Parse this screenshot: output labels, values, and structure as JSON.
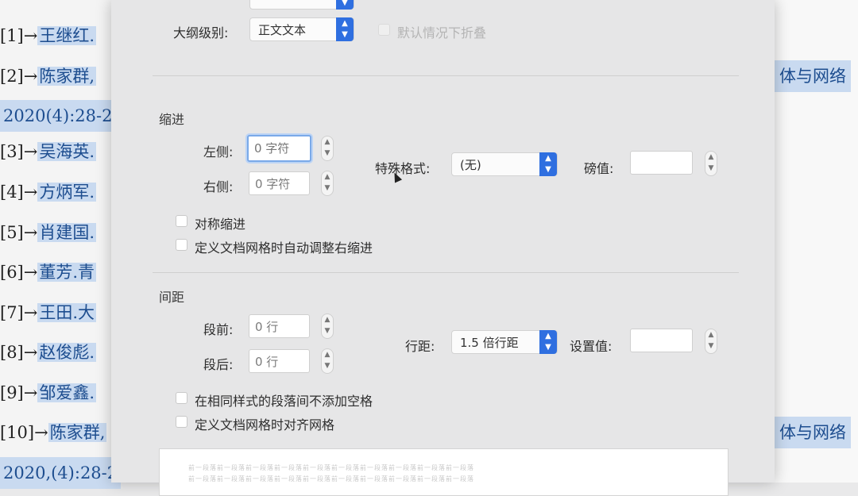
{
  "document": {
    "references": [
      {
        "num": "[1]→",
        "text": "王继红."
      },
      {
        "num": "[2]→",
        "text": "陈家群,"
      },
      {
        "num": "",
        "text": "2020(4):28-2"
      },
      {
        "num": "[3]→",
        "text": "吴海英."
      },
      {
        "num": "[4]→",
        "text": "方炳军."
      },
      {
        "num": "[5]→",
        "text": "肖建国."
      },
      {
        "num": "[6]→",
        "text": "董芳.青"
      },
      {
        "num": "[7]→",
        "text": "王田.大"
      },
      {
        "num": "[8]→",
        "text": "赵俊彪."
      },
      {
        "num": "[9]→",
        "text": "邹爱鑫."
      },
      {
        "num": "[10]→",
        "text": "陈家群,"
      },
      {
        "num": "",
        "text": "2020,(4):28-2"
      }
    ],
    "right_fragments": [
      "体与网络",
      "体与网络"
    ]
  },
  "dialog": {
    "outline_level": {
      "label": "大纲级别:",
      "value": "正文文本"
    },
    "collapse_default": {
      "label": "默认情况下折叠"
    },
    "indent": {
      "title": "缩进",
      "left_label": "左侧:",
      "left_value": "0 字符",
      "right_label": "右侧:",
      "right_value": "0 字符",
      "special_label": "特殊格式:",
      "special_value": "(无)",
      "amount_label": "磅值:",
      "amount_value": "",
      "mirror_label": "对称缩进",
      "auto_adjust_label": "定义文档网格时自动调整右缩进"
    },
    "spacing": {
      "title": "间距",
      "before_label": "段前:",
      "before_value": "0 行",
      "after_label": "段后:",
      "after_value": "0 行",
      "line_spacing_label": "行距:",
      "line_spacing_value": "1.5 倍行距",
      "setting_label": "设置值:",
      "setting_value": "",
      "no_space_same_style_label": "在相同样式的段落间不添加空格",
      "snap_to_grid_label": "定义文档网格时对齐网格"
    },
    "preview": {
      "lines": [
        "前一段落前一段落前一段落前一段落前一段落前一段落前一段落前一段落前一段落前一段落",
        "前一段落前一段落前一段落前一段落前一段落前一段落前一段落前一段落前一段落前一段落"
      ]
    }
  }
}
